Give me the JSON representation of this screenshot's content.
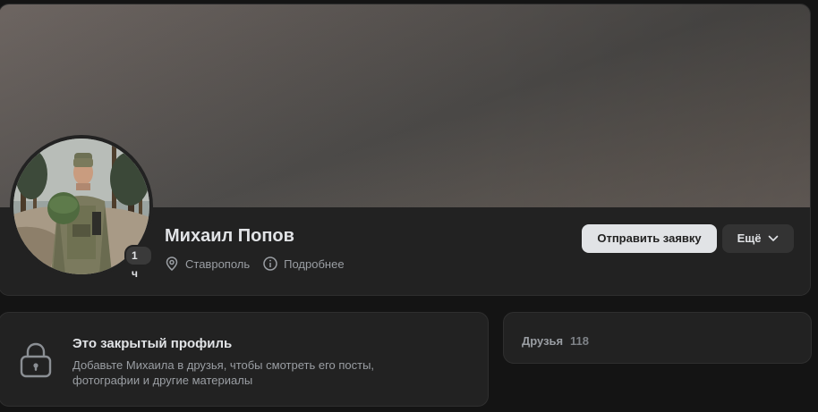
{
  "profile": {
    "name": "Михаил Попов",
    "online_badge": "1 ч",
    "city": "Ставрополь",
    "details_label": "Подробнее",
    "add_friend_label": "Отправить заявку",
    "more_label": "Ещё"
  },
  "closed_profile": {
    "title": "Это закрытый профиль",
    "description": "Добавьте Михаила в друзья, чтобы смотреть его посты, фотографии и другие материалы"
  },
  "friends": {
    "label": "Друзья",
    "count": "118"
  },
  "icons": {
    "location": "location-pin-icon",
    "info": "info-icon",
    "chevron": "chevron-down-icon",
    "lock": "lock-icon"
  },
  "colors": {
    "background": "#141414",
    "card": "#222222",
    "primary_button": "#e1e3e6",
    "secondary_button": "#333333",
    "text_primary": "#e1e3e6",
    "text_secondary": "#9a9ea3"
  }
}
